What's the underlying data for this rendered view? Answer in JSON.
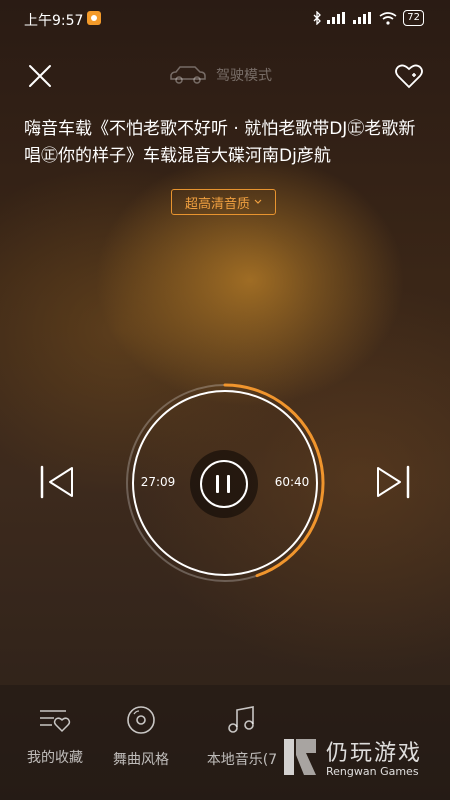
{
  "status": {
    "time": "上午9:57",
    "battery": "72"
  },
  "header": {
    "mode_label": "驾驶模式",
    "icons": [
      "close-icon",
      "car-icon",
      "heart-add-icon"
    ]
  },
  "song": {
    "title": "嗨音车载《不怕老歌不好听 · 就怕老歌带DJ㊣老歌新唱㊣你的样子》车载混音大碟河南Dj彦航"
  },
  "quality": {
    "label": "超高清音质",
    "accent": "#e8942f"
  },
  "player": {
    "elapsed": "27:09",
    "total": "60:40",
    "progress": 0.447,
    "state": "playing"
  },
  "tabs": [
    {
      "label": "我的收藏",
      "icon": "favorites-list-icon"
    },
    {
      "label": "舞曲风格",
      "icon": "disc-icon"
    },
    {
      "label": "本地音乐(7",
      "icon": "music-note-icon"
    }
  ],
  "watermark": {
    "cn": "仍玩游戏",
    "en": "Rengwan Games"
  }
}
